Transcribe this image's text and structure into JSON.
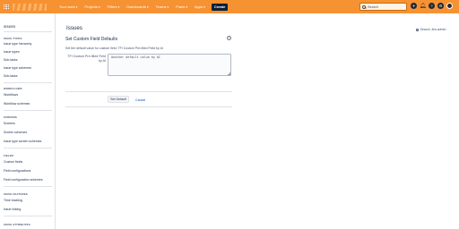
{
  "colors": {
    "topbar": "#f79232",
    "create": "#0b1f3a",
    "link": "#0052cc"
  },
  "topnav": {
    "items": [
      "Your work",
      "Projects",
      "Filters",
      "Dashboards",
      "Teams",
      "Plans",
      "Apps"
    ],
    "create_label": "Create",
    "search_placeholder": "Search",
    "icons": [
      "sparkle-icon",
      "notifications-icon",
      "help-icon",
      "settings-icon",
      "avatar"
    ]
  },
  "sidebar": {
    "title": "ISSUES",
    "sections": [
      {
        "heading": "ISSUE TYPES",
        "items": [
          "Issue type hierarchy",
          "Issue types",
          "Sub-tasks",
          "Issue type schemes",
          "Sub-tasks"
        ]
      },
      {
        "heading": "WORKFLOWS",
        "items": [
          "Workflows",
          "Workflow schemes"
        ]
      },
      {
        "heading": "SCREENS",
        "items": [
          "Screens",
          "Screen schemes",
          "Issue type screen schemes"
        ]
      },
      {
        "heading": "FIELDS",
        "items": [
          "Custom fields",
          "Field configurations",
          "Field configuration schemes"
        ]
      },
      {
        "heading": "ISSUE FEATURES",
        "items": [
          "Time tracking",
          "Issue linking"
        ]
      },
      {
        "heading": "ISSUE ATTRIBUTES",
        "items": []
      }
    ]
  },
  "main": {
    "page_title": "Issues",
    "search_admin": "Search Jira admin",
    "section_title": "Set Custom Field Defaults",
    "description": "Set the default value for custom field: TFI Custom Pre-filled Field by AI",
    "field_label": "TFI Custom Pre-filled Field by AI",
    "field_value": "Another default value by AI",
    "set_default_label": "Set Default",
    "cancel_label": "Cancel"
  }
}
